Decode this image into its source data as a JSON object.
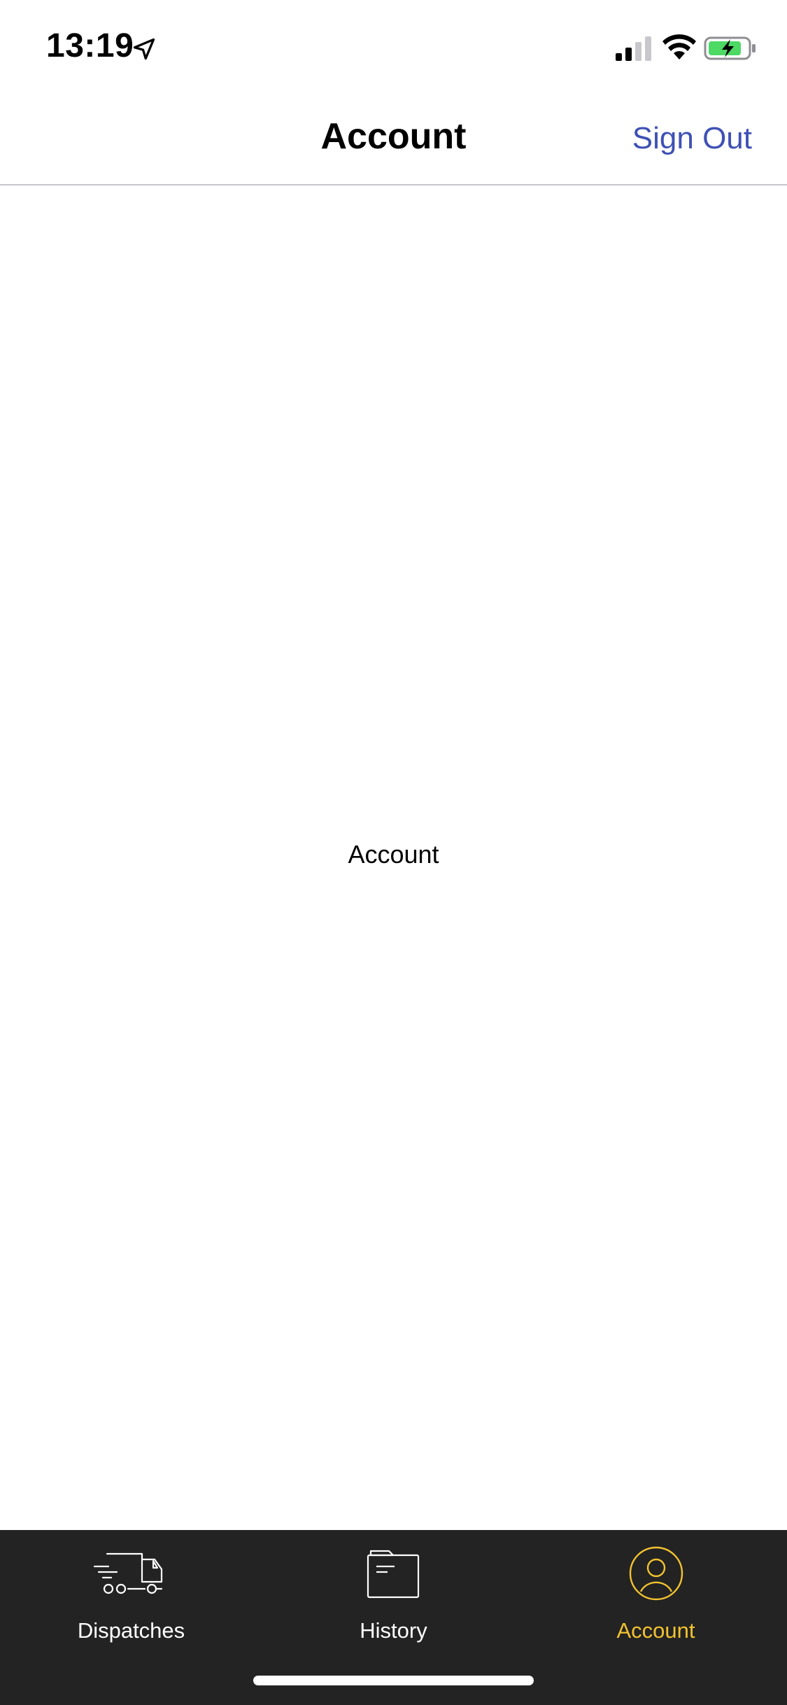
{
  "status_bar": {
    "time": "13:19"
  },
  "nav": {
    "title": "Account",
    "sign_out_label": "Sign Out"
  },
  "main": {
    "placeholder_text": "Account"
  },
  "tabs": [
    {
      "label": "Dispatches",
      "icon": "truck-icon",
      "active": false
    },
    {
      "label": "History",
      "icon": "folder-icon",
      "active": false
    },
    {
      "label": "Account",
      "icon": "user-circle-icon",
      "active": true
    }
  ],
  "colors": {
    "accent": "#3f51b5",
    "active_tab": "#f2c230",
    "tab_bar_bg": "#232323",
    "battery_green": "#4cd964"
  }
}
